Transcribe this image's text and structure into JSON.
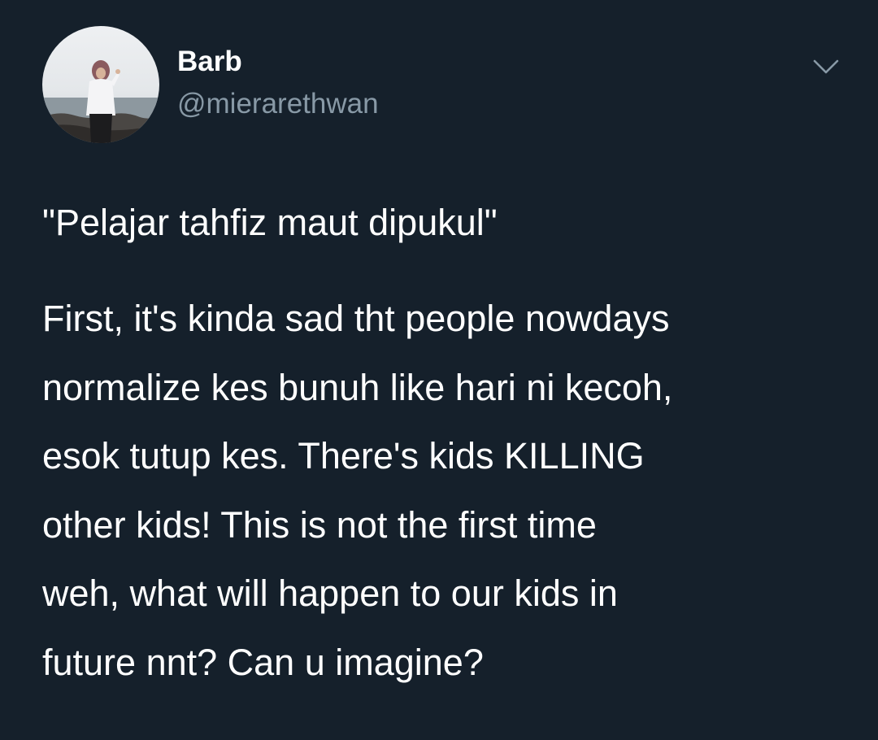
{
  "user": {
    "display_name": "Barb",
    "handle": "@mierarethwan"
  },
  "icons": {
    "avatar": "profile-photo",
    "menu": "chevron-down-icon"
  },
  "tweet": {
    "headline": "\"Pelajar tahfiz maut dipukul\"",
    "body_lines": [
      "First, it's kinda sad tht people nowdays",
      "normalize kes bunuh like hari ni kecoh,",
      "esok tutup kes. There's kids KILLING",
      "other kids! This is not the first time",
      "weh, what will happen to our kids in",
      "future nnt? Can u imagine?"
    ]
  },
  "colors": {
    "background": "#15202b",
    "text_primary": "#ffffff",
    "text_secondary": "#8899a6"
  }
}
